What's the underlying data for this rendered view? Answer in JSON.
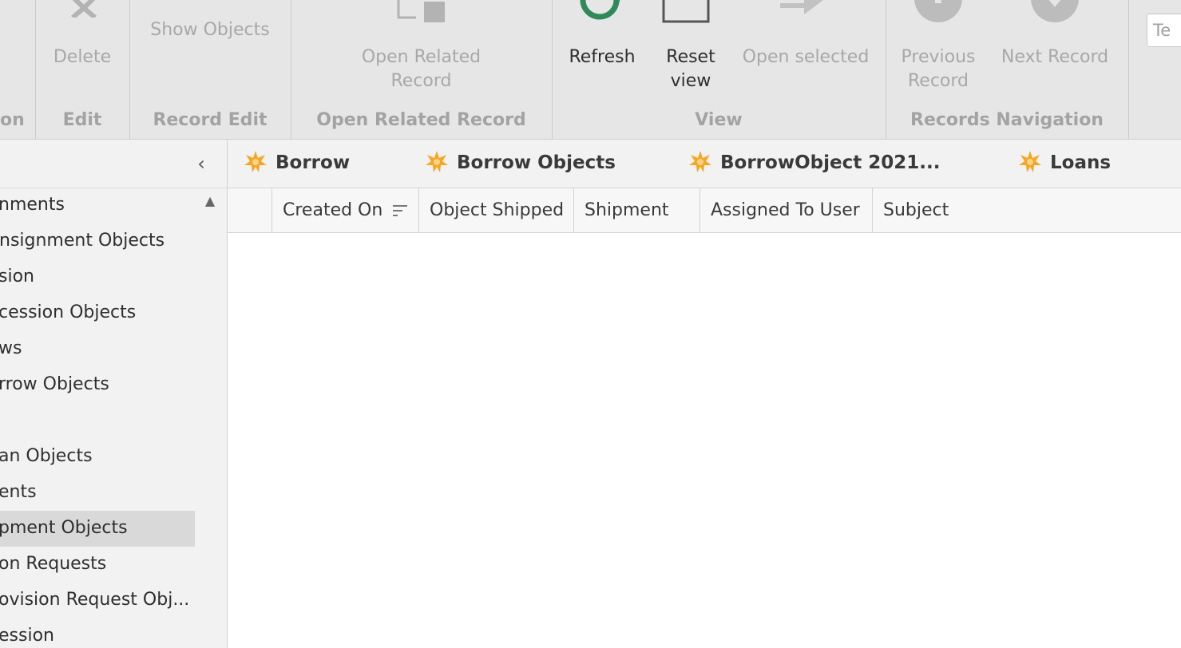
{
  "ribbon": {
    "groups": {
      "partial_left": "on",
      "edit": "Edit",
      "record_edit": "Record Edit",
      "open_related_record": "Open Related Record",
      "view": "View",
      "records_navigation": "Records Navigation"
    },
    "buttons": {
      "delete": "Delete",
      "show_objects": "Show Objects",
      "open_related_record_l1": "Open Related",
      "open_related_record_l2": "Record",
      "refresh": "Refresh",
      "reset_view_l1": "Reset",
      "reset_view_l2": "view",
      "open_selected": "Open selected",
      "previous_record_l1": "Previous",
      "previous_record_l2": "Record",
      "next_record": "Next Record"
    },
    "search_field_text": "Te"
  },
  "sidebar": {
    "items": [
      {
        "label": "nments"
      },
      {
        "label": "nsignment Objects"
      },
      {
        "label": "sion"
      },
      {
        "label": "cession Objects"
      },
      {
        "label": "ws"
      },
      {
        "label": "rrow Objects"
      },
      {
        "label": ""
      },
      {
        "label": "an Objects"
      },
      {
        "label": "ents"
      },
      {
        "label": "pment Objects",
        "selected": true
      },
      {
        "label": "on Requests"
      },
      {
        "label": "ovision Request Obj..."
      },
      {
        "label": "ession"
      }
    ]
  },
  "tabs": [
    {
      "label": "Borrow"
    },
    {
      "label": "Borrow Objects"
    },
    {
      "label": "BorrowObject 2021..."
    },
    {
      "label": "Loans"
    }
  ],
  "grid": {
    "columns": [
      {
        "label": ""
      },
      {
        "label": "Created On"
      },
      {
        "label": "Object Shipped"
      },
      {
        "label": "Shipment"
      },
      {
        "label": "Assigned To User"
      },
      {
        "label": "Subject"
      }
    ]
  },
  "colors": {
    "refresh_icon": "#2e8b57",
    "tab_star": "#f5a623",
    "selected_row": "#d9d9d9"
  },
  "icons": {
    "delete": "close-x-icon",
    "open_related_record": "document-link-icon",
    "refresh": "refresh-icon",
    "reset_view": "reset-view-icon",
    "open_selected": "arrow-right-icon",
    "previous_record": "previous-record-icon",
    "next_record": "next-record-icon",
    "tab": "star-icon",
    "sort": "sort-icon"
  }
}
